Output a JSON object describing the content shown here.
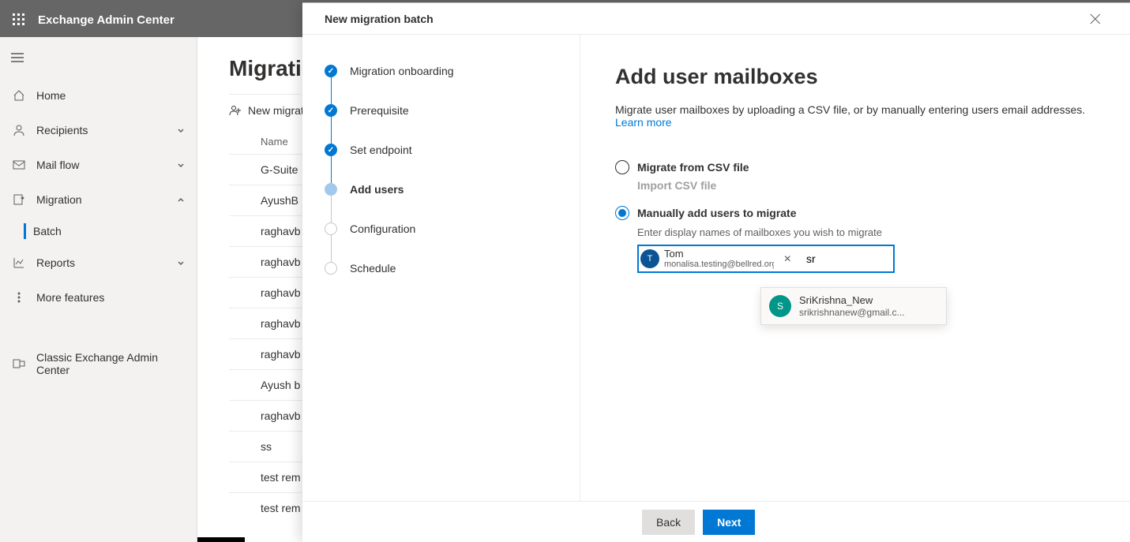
{
  "header": {
    "title": "Exchange Admin Center"
  },
  "sidebar": {
    "items": [
      {
        "label": "Home",
        "icon": "home"
      },
      {
        "label": "Recipients",
        "icon": "recipients",
        "expand": "down"
      },
      {
        "label": "Mail flow",
        "icon": "mailflow",
        "expand": "down"
      },
      {
        "label": "Migration",
        "icon": "migration",
        "expand": "up",
        "children": [
          {
            "label": "Batch",
            "active": true
          }
        ]
      },
      {
        "label": "Reports",
        "icon": "reports",
        "expand": "down"
      },
      {
        "label": "More features",
        "icon": "more"
      },
      {
        "label": "Classic Exchange Admin Center",
        "icon": "classic"
      }
    ]
  },
  "content": {
    "heading": "Migrati",
    "toolbar_new": "New migrat",
    "table_header": "Name",
    "rows": [
      "G-Suite",
      "AyushB",
      "raghavb",
      "raghavb",
      "raghavb",
      "raghavb",
      "raghavb",
      "Ayush b",
      "raghavb",
      "ss",
      "test rem",
      "test rem"
    ]
  },
  "panel": {
    "title": "New migration batch",
    "steps": [
      "Migration onboarding",
      "Prerequisite",
      "Set endpoint",
      "Add users",
      "Configuration",
      "Schedule"
    ],
    "h2": "Add user mailboxes",
    "desc": "Migrate user mailboxes by uploading a CSV file, or by manually entering users email addresses. ",
    "learn_more": "Learn more",
    "opt_csv": "Migrate from CSV file",
    "opt_csv_sub": "Import CSV file",
    "opt_manual": "Manually add users to migrate",
    "opt_manual_hint": "Enter display names of mailboxes you wish to migrate",
    "chip": {
      "initial": "T",
      "name": "Tom",
      "email": "monalisa.testing@bellred.org"
    },
    "input_value": "sr",
    "suggestion": {
      "initial": "S",
      "name": "SriKrishna_New",
      "email": "srikrishnanew@gmail.c..."
    },
    "back": "Back",
    "next": "Next"
  }
}
